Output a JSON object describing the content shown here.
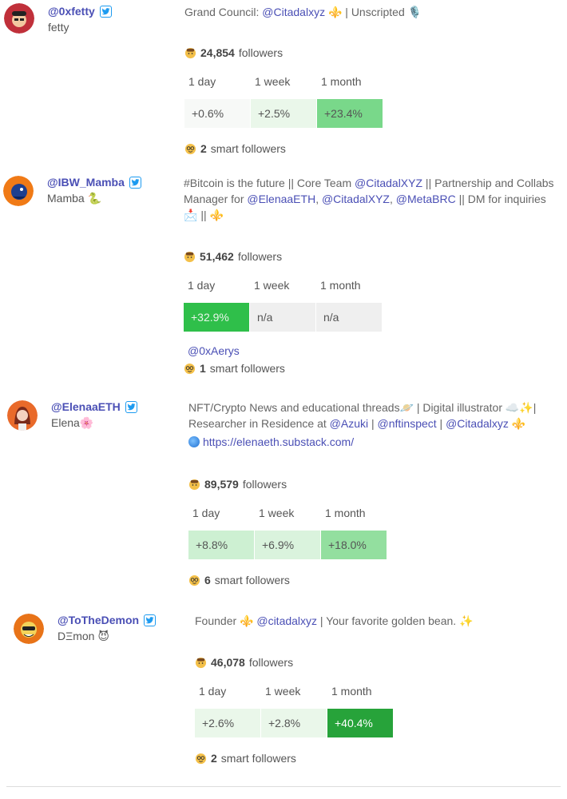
{
  "accounts": [
    {
      "handle": "@0xfetty",
      "display_name": "fetty",
      "bio_parts": [
        "Grand Council: ",
        "@Citadalxyz",
        " ⚜️ | Unscripted 🎙️"
      ],
      "followers_count": "24,854",
      "followers_label": "followers",
      "growth_headers": [
        "1 day",
        "1 week",
        "1 month"
      ],
      "growth_values": [
        "+0.6%",
        "+2.5%",
        "+23.4%"
      ],
      "growth_colors": [
        "#f7f9f7",
        "#eaf7ea",
        "#79d88a"
      ],
      "smart_count": "2",
      "smart_label": "smart followers",
      "avatar_color": "#c0303a"
    },
    {
      "handle": "@IBW_Mamba",
      "display_name": "Mamba 🐍",
      "bio_parts": [
        "#Bitcoin is the future || Core Team ",
        "@CitadalXYZ",
        " || Partnership and Collabs Manager for ",
        "@ElenaaETH",
        ", ",
        "@CitadalXYZ",
        ", ",
        "@MetaBRC",
        " || DM for inquiries 📩 || ⚜️"
      ],
      "followers_count": "51,462",
      "followers_label": "followers",
      "growth_headers": [
        "1 day",
        "1 week",
        "1 month"
      ],
      "growth_values": [
        "+32.9%",
        "n/a",
        "n/a"
      ],
      "growth_colors": [
        "#2fbf4a",
        "#efefef",
        "#efefef"
      ],
      "smart_mention": "@0xAerys",
      "smart_count": "1",
      "smart_label": "smart followers",
      "avatar_color": "#f07a16"
    },
    {
      "handle": "@ElenaaETH",
      "display_name": "Elena🌸",
      "bio_parts": [
        "NFT/Crypto News and educational threads🪐 | Digital illustrator ☁️✨| Researcher in Residence at ",
        "@Azuki",
        " | ",
        "@nftinspect",
        " | ",
        "@Citadalxyz",
        " ⚜️"
      ],
      "link": "https://elenaeth.substack.com/",
      "followers_count": "89,579",
      "followers_label": "followers",
      "growth_headers": [
        "1 day",
        "1 week",
        "1 month"
      ],
      "growth_values": [
        "+8.8%",
        "+6.9%",
        "+18.0%"
      ],
      "growth_colors": [
        "#cdf0d2",
        "#daf3dd",
        "#93df9f"
      ],
      "smart_count": "6",
      "smart_label": "smart followers",
      "avatar_color": "#e96a2a"
    },
    {
      "handle": "@ToTheDemon",
      "display_name": "DΞmon 😈",
      "bio_parts": [
        "Founder ⚜️ ",
        "@citadalxyz",
        " | Your favorite golden bean. ✨"
      ],
      "followers_count": "46,078",
      "followers_label": "followers",
      "growth_headers": [
        "1 day",
        "1 week",
        "1 month"
      ],
      "growth_values": [
        "+2.6%",
        "+2.8%",
        "+40.4%"
      ],
      "growth_colors": [
        "#eaf7ea",
        "#eaf7ea",
        "#27a33a"
      ],
      "smart_count": "2",
      "smart_label": "smart followers",
      "avatar_color": "#e87318"
    }
  ]
}
